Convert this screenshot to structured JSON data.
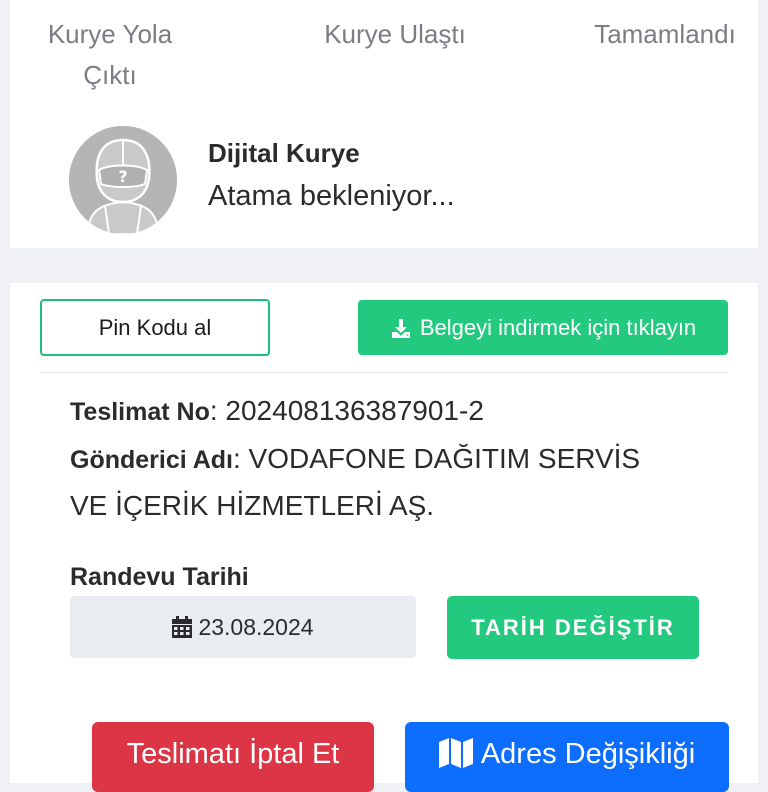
{
  "progress_steps": [
    {
      "line1": "Kurye Yola",
      "line2": "Çıktı"
    },
    {
      "line1": "Kurye Ulaştı",
      "line2": ""
    },
    {
      "line1": "Tamamlandı",
      "line2": ""
    }
  ],
  "courier": {
    "name": "Dijital Kurye",
    "status": "Atama bekleniyor..."
  },
  "actions": {
    "pin_label": "Pin Kodu al",
    "download_label": "Belgeyi indirmek için tıklayın"
  },
  "delivery": {
    "no_label": "Teslimat No",
    "no_value": "202408136387901-2",
    "sender_label": "Gönderici Adı",
    "sender_value_line1": "VODAFONE DAĞITIM SERVİS",
    "sender_value_line2": "VE İÇERİK HİZMETLERİ AŞ."
  },
  "appointment": {
    "label": "Randevu Tarihi",
    "date": "23.08.2024",
    "change_label": "TARİH DEĞİŞTİR"
  },
  "bottom_buttons": {
    "cancel_label": "Teslimatı İptal Et",
    "address_label": "Adres Değişikliği"
  },
  "colors": {
    "green": "#22c97e",
    "red": "#dc3545",
    "blue": "#0d6efd"
  }
}
